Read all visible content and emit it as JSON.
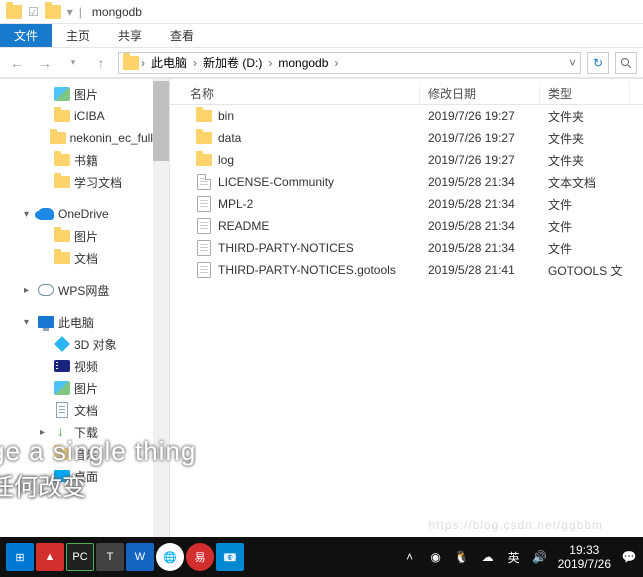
{
  "titlebar": {
    "title": "mongodb"
  },
  "ribbon": {
    "file": "文件",
    "home": "主页",
    "share": "共享",
    "view": "查看"
  },
  "breadcrumb": {
    "pc": "此电脑",
    "drive": "新加卷 (D:)",
    "folder": "mongodb"
  },
  "columns": {
    "name": "名称",
    "date": "修改日期",
    "type": "类型"
  },
  "files": [
    {
      "name": "bin",
      "date": "2019/7/26 19:27",
      "type": "文件夹",
      "icon": "folder"
    },
    {
      "name": "data",
      "date": "2019/7/26 19:27",
      "type": "文件夹",
      "icon": "folder"
    },
    {
      "name": "log",
      "date": "2019/7/26 19:27",
      "type": "文件夹",
      "icon": "folder"
    },
    {
      "name": "LICENSE-Community",
      "date": "2019/5/28 21:34",
      "type": "文本文档",
      "icon": "txt"
    },
    {
      "name": "MPL-2",
      "date": "2019/5/28 21:34",
      "type": "文件",
      "icon": "file"
    },
    {
      "name": "README",
      "date": "2019/5/28 21:34",
      "type": "文件",
      "icon": "file"
    },
    {
      "name": "THIRD-PARTY-NOTICES",
      "date": "2019/5/28 21:34",
      "type": "文件",
      "icon": "file"
    },
    {
      "name": "THIRD-PARTY-NOTICES.gotools",
      "date": "2019/5/28 21:41",
      "type": "GOTOOLS 文",
      "icon": "file"
    }
  ],
  "sidebar": [
    {
      "label": "图片",
      "icon": "pic",
      "indent": 28,
      "arrow": ""
    },
    {
      "label": "iCIBA",
      "icon": "folder",
      "indent": 28,
      "arrow": ""
    },
    {
      "label": "nekonin_ec_full",
      "icon": "folder",
      "indent": 28,
      "arrow": ""
    },
    {
      "label": "书籍",
      "icon": "folder",
      "indent": 28,
      "arrow": ""
    },
    {
      "label": "学习文档",
      "icon": "folder",
      "indent": 28,
      "arrow": ""
    },
    {
      "label": "OneDrive",
      "icon": "onedrive",
      "indent": 12,
      "arrow": "▾",
      "gap": true
    },
    {
      "label": "图片",
      "icon": "folder",
      "indent": 28,
      "arrow": ""
    },
    {
      "label": "文档",
      "icon": "folder",
      "indent": 28,
      "arrow": ""
    },
    {
      "label": "WPS网盘",
      "icon": "wps",
      "indent": 12,
      "arrow": "▸",
      "gap": true
    },
    {
      "label": "此电脑",
      "icon": "pc",
      "indent": 12,
      "arrow": "▾",
      "gap": true
    },
    {
      "label": "3D 对象",
      "icon": "cube",
      "indent": 28,
      "arrow": ""
    },
    {
      "label": "视频",
      "icon": "video",
      "indent": 28,
      "arrow": ""
    },
    {
      "label": "图片",
      "icon": "pic",
      "indent": 28,
      "arrow": ""
    },
    {
      "label": "文档",
      "icon": "doc",
      "indent": 28,
      "arrow": ""
    },
    {
      "label": "下载",
      "icon": "dl",
      "indent": 28,
      "arrow": "▸"
    },
    {
      "label": "音乐",
      "icon": "folder",
      "indent": 28,
      "arrow": ""
    },
    {
      "label": "桌面",
      "icon": "desk",
      "indent": 28,
      "arrow": ""
    }
  ],
  "overlay": {
    "line1": "ge a single thing",
    "line2": "任何改变"
  },
  "watermark": "https://blog.csdn.net/ggbbm",
  "tray": {
    "time": "19:33",
    "date": "2019/7/26",
    "ime": "英"
  }
}
